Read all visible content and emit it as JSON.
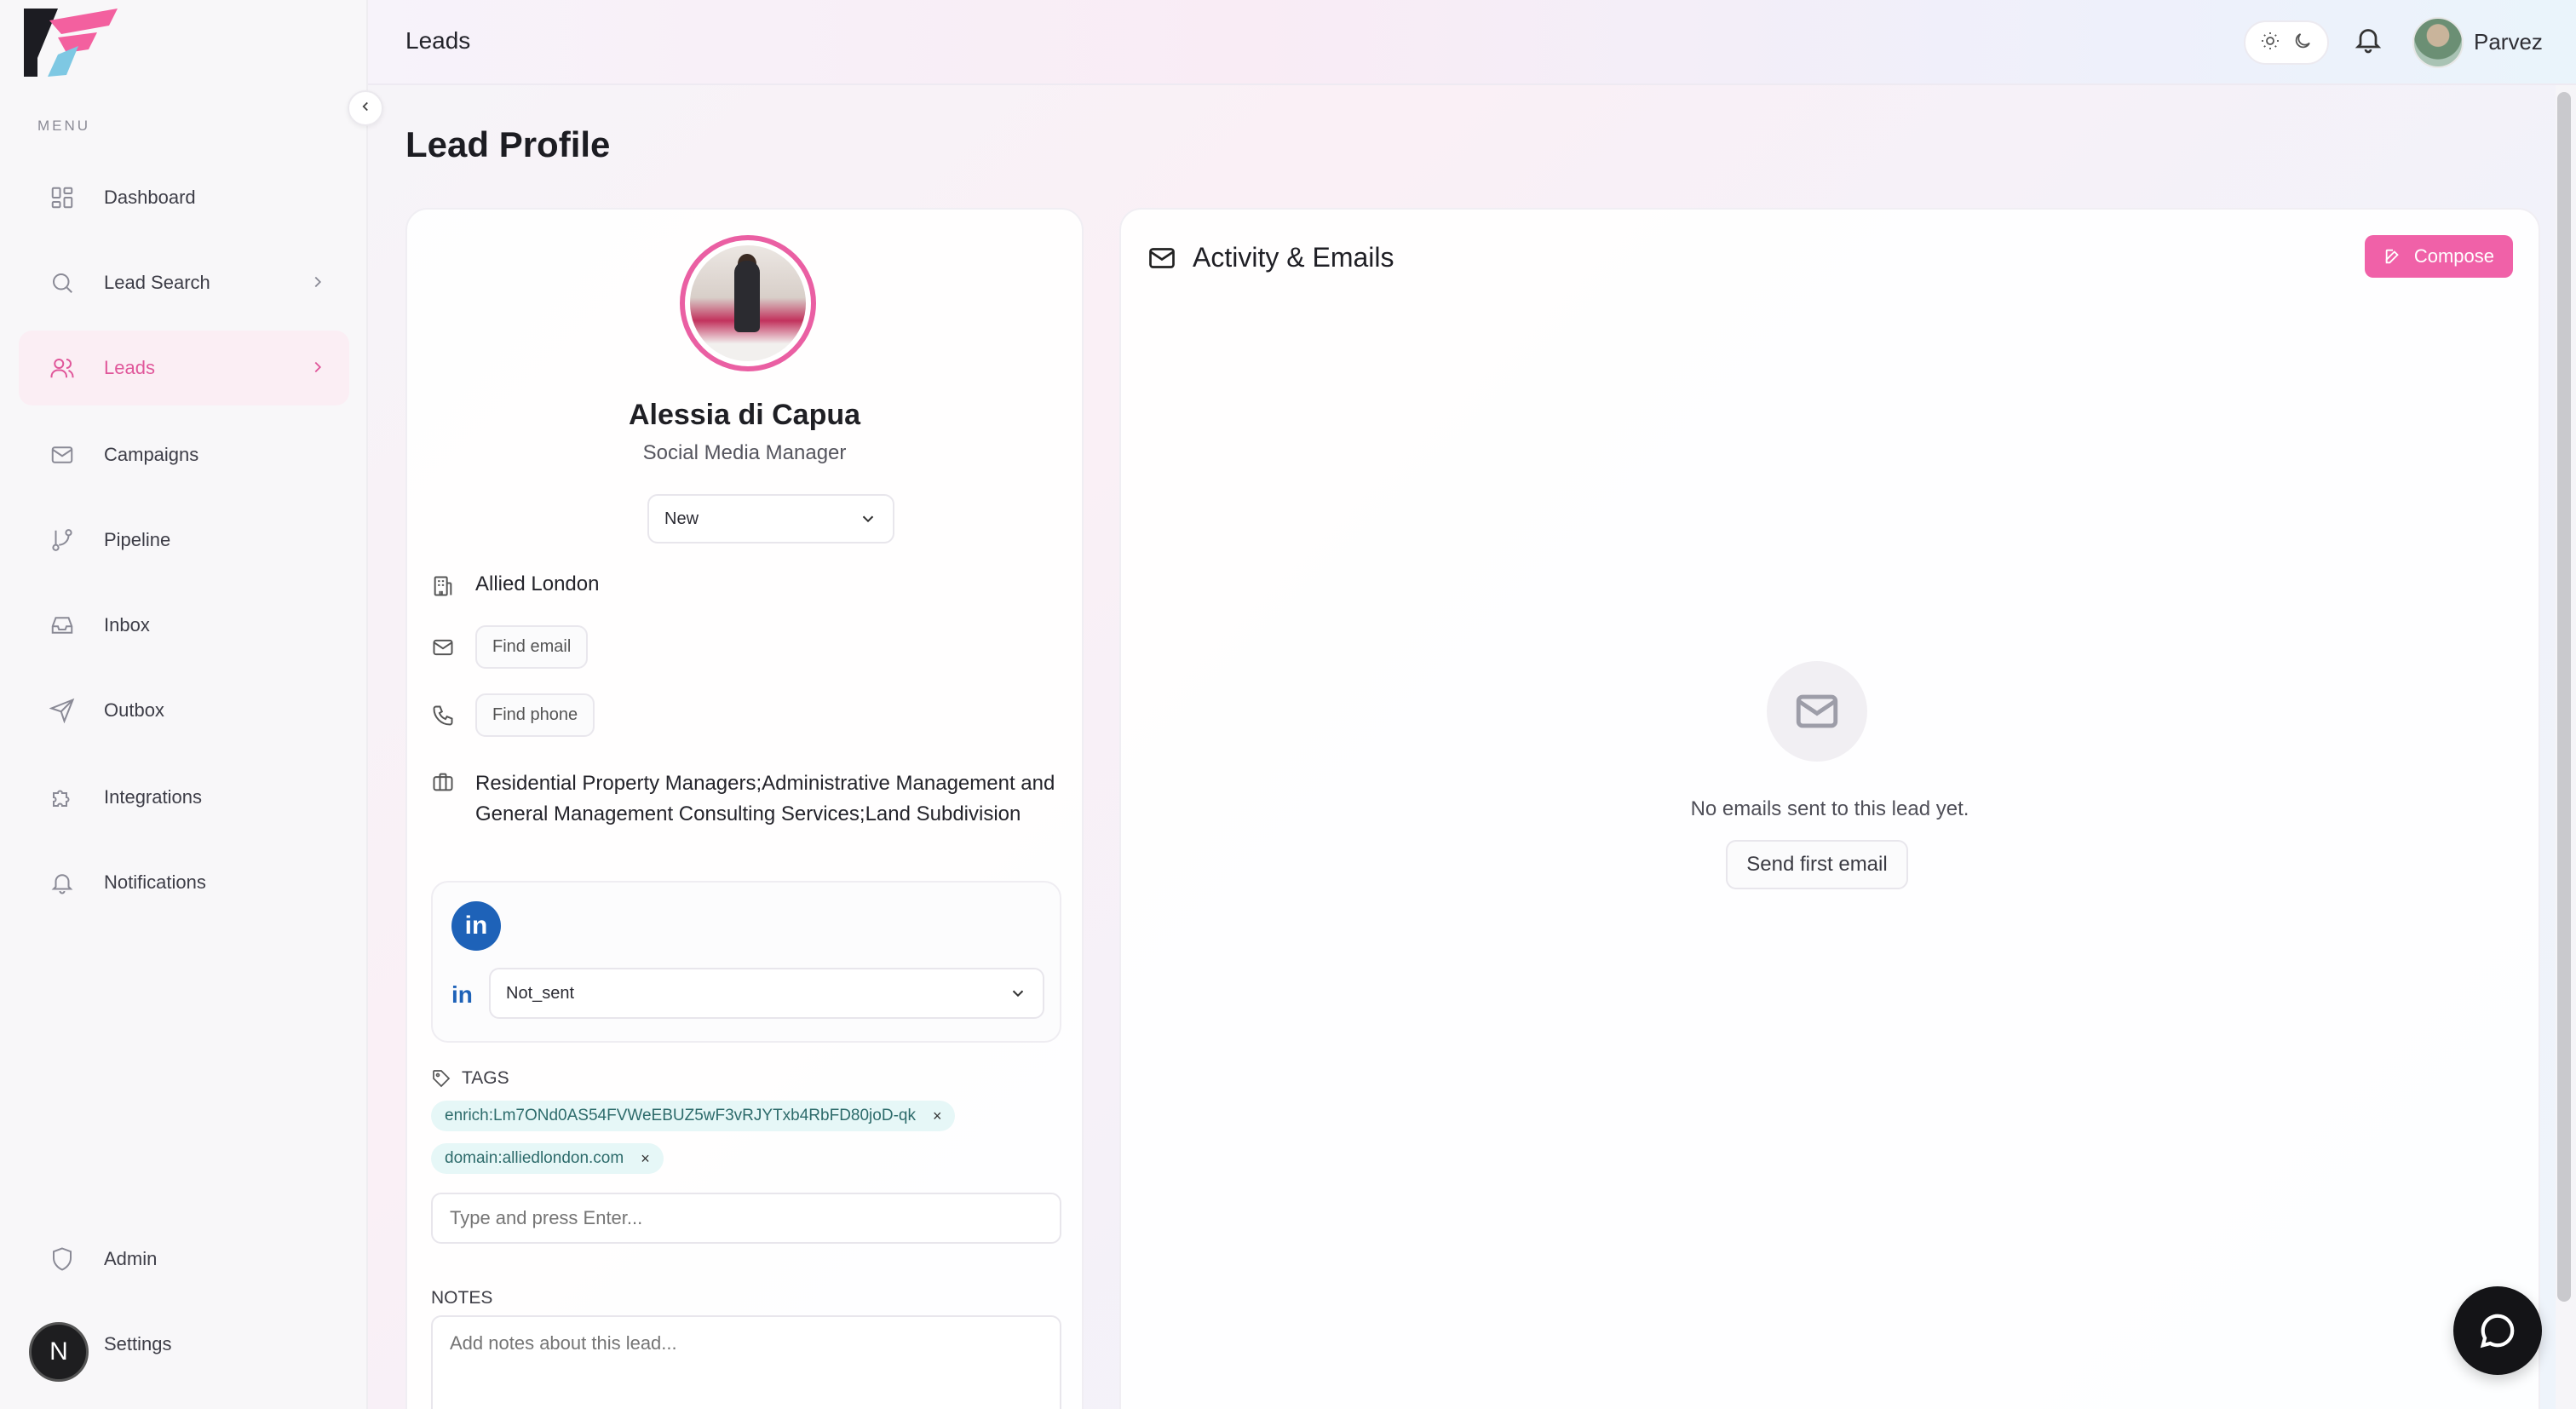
{
  "app": {
    "accent_color": "#f061a8",
    "brand_colors": [
      "#1c1c22",
      "#f3609f",
      "#7ec8e3"
    ]
  },
  "header": {
    "title": "Leads",
    "theme_icons": [
      "sun-icon",
      "moon-icon"
    ],
    "notification_icon": "bell-icon",
    "user_name": "Parvez"
  },
  "sidebar": {
    "menu_label": "MENU",
    "items": [
      {
        "label": "Dashboard",
        "icon": "dashboard-icon"
      },
      {
        "label": "Lead Search",
        "icon": "search-icon",
        "has_chevron": true
      },
      {
        "label": "Leads",
        "icon": "users-icon",
        "has_chevron": true,
        "active": true
      },
      {
        "label": "Campaigns",
        "icon": "mail-icon"
      },
      {
        "label": "Pipeline",
        "icon": "git-branch-icon"
      },
      {
        "label": "Inbox",
        "icon": "inbox-icon"
      },
      {
        "label": "Outbox",
        "icon": "send-icon"
      },
      {
        "label": "Integrations",
        "icon": "puzzle-icon"
      },
      {
        "label": "Notifications",
        "icon": "bell-icon"
      }
    ],
    "bottom_items": [
      {
        "label": "Admin",
        "icon": "shield-icon"
      },
      {
        "label": "Settings",
        "icon": "gear-icon"
      }
    ],
    "user_initial": "N"
  },
  "page": {
    "title": "Lead Profile"
  },
  "profile": {
    "name": "Alessia di Capua",
    "job_title": "Social Media Manager",
    "status": "New",
    "company": "Allied London",
    "find_email_label": "Find email",
    "find_phone_label": "Find phone",
    "industry": "Residential Property Managers;Administrative Management and General Management Consulting Services;Land Subdivision",
    "linkedin_badge": "in",
    "linkedin_status": "Not_sent",
    "tags_label": "TAGS",
    "tags": [
      "enrich:Lm7ONd0AS54FVWeEBUZ5wF3vRJYTxb4RbFD80joD-qk",
      "domain:alliedlondon.com"
    ],
    "tag_remove": "×",
    "tag_input_placeholder": "Type and press Enter...",
    "notes_label": "NOTES",
    "notes_placeholder": "Add notes about this lead..."
  },
  "activity": {
    "title": "Activity & Emails",
    "compose_label": "Compose",
    "empty_text": "No emails sent to this lead yet.",
    "send_first_label": "Send first email"
  }
}
